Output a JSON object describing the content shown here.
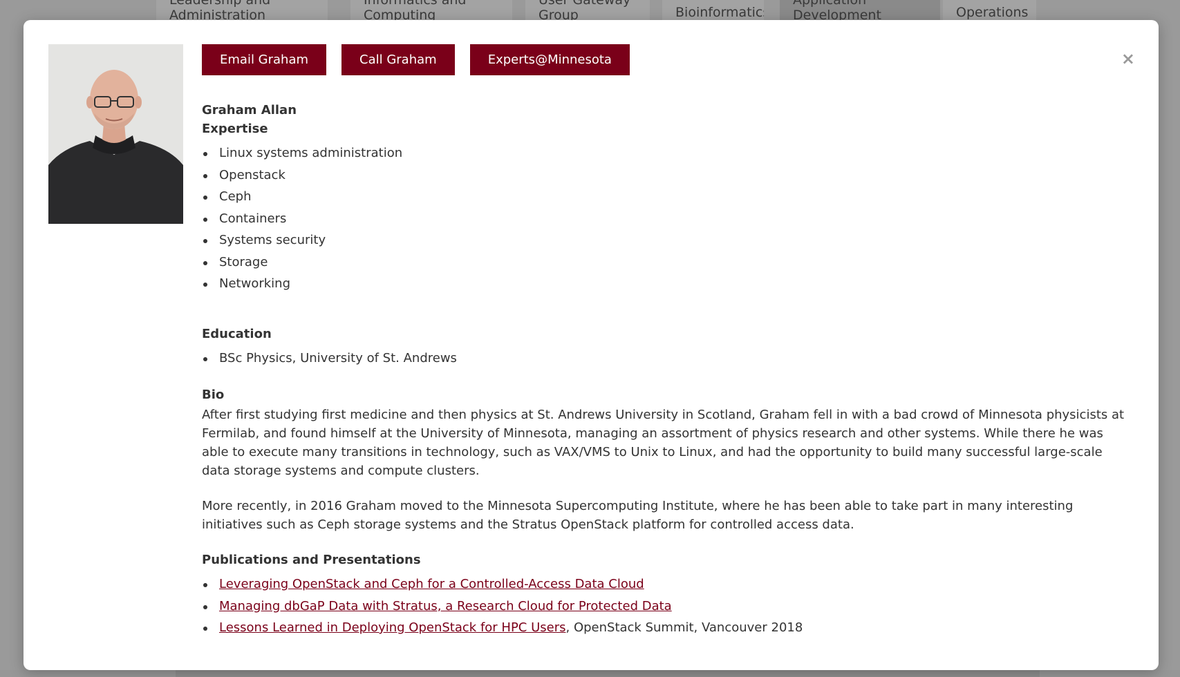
{
  "background_tabs": [
    {
      "line1": "Leadership and",
      "line2": "Administration",
      "active": false
    },
    {
      "line1": "Informatics and",
      "line2": "Computing",
      "active": false
    },
    {
      "line1": "User Gateway",
      "line2": "Group",
      "active": false
    },
    {
      "line1": "Bioinformatics",
      "line2": "",
      "active": false
    },
    {
      "line1": "Application",
      "line2": "Development",
      "active": true
    },
    {
      "line1": "Operations",
      "line2": "",
      "active": false
    }
  ],
  "modal": {
    "close_symbol": "×",
    "buttons": {
      "email": "Email Graham",
      "call": "Call Graham",
      "experts": "Experts@Minnesota"
    },
    "name": "Graham Allan",
    "expertise_heading": "Expertise",
    "expertise": [
      "Linux systems administration",
      "Openstack",
      "Ceph",
      "Containers",
      "Systems security",
      "Storage",
      "Networking"
    ],
    "education_heading": "Education",
    "education": [
      "BSc Physics, University of St. Andrews"
    ],
    "bio_heading": "Bio",
    "bio_p1": "After first studying first medicine and then physics at St. Andrews University in Scotland, Graham fell in with a bad crowd of Minnesota physicists at Fermilab, and found himself at the University of Minnesota, managing an assortment of physics research and other systems. While there he was able to execute many transitions in technology, such as VAX/VMS to Unix to Linux, and had the opportunity to build many successful large-scale data storage systems and compute clusters.",
    "bio_p2": "More recently, in 2016 Graham moved to the Minnesota Supercomputing Institute, where he has been able to take part in many interesting initiatives such as Ceph storage systems and the Stratus OpenStack platform for controlled access data.",
    "publications_heading": "Publications and Presentations",
    "publications": [
      {
        "link": "Leveraging OpenStack and Ceph for a Controlled-Access Data Cloud",
        "suffix": ""
      },
      {
        "link": "Managing dbGaP Data with Stratus, a Research Cloud for Protected Data",
        "suffix": ""
      },
      {
        "link": "Lessons Learned in Deploying OpenStack for HPC Users",
        "suffix": ", OpenStack Summit, Vancouver 2018"
      }
    ]
  },
  "colors": {
    "accent": "#7a0019",
    "overlay": "#9a9a9a"
  }
}
